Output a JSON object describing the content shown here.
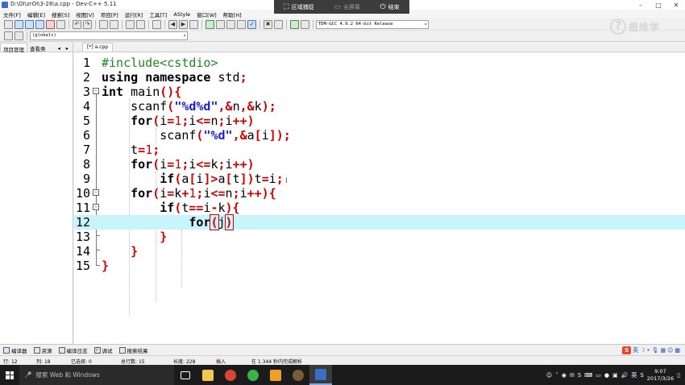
{
  "window": {
    "title": "D:\\OI\\zrOI\\3-26\\a.cpp - Dev-C++ 5.11"
  },
  "capture_bar": {
    "region": "区域捕捉",
    "fullscreen": "全屏幕",
    "end": "结束"
  },
  "menu": [
    "文件[F]",
    "编辑[E]",
    "搜索[S]",
    "视图[V]",
    "项目[P]",
    "运行[R]",
    "工具[T]",
    "AStyle",
    "窗口[W]",
    "帮助[H]"
  ],
  "toolbar": {
    "compiler_select": "TDM-GCC 4.9.2 64-bit Release",
    "scope_select": "(globals)"
  },
  "watermark": {
    "text": "根维学"
  },
  "left_panel": {
    "tabs": [
      "项目管理",
      "查看类"
    ]
  },
  "editor": {
    "file_tab": "[*] a.cpp",
    "line_numbers": [
      "1",
      "2",
      "3",
      "4",
      "5",
      "6",
      "7",
      "8",
      "9",
      "10",
      "11",
      "12",
      "13",
      "14",
      "15"
    ]
  },
  "bottom_tabs": [
    "编译器",
    "资源",
    "编译日志",
    "调试",
    "搜索结果"
  ],
  "ime": {
    "label": "英"
  },
  "status": {
    "row_label": "行:",
    "row": "12",
    "col_label": "列:",
    "col": "18",
    "selected_label": "已选择:",
    "selected": "0",
    "total_label": "总行数:",
    "total": "15",
    "length_label": "长度:",
    "length": "228",
    "mode": "插入",
    "parse_msg": "在 1.344 秒内完成解析"
  },
  "taskbar": {
    "search_placeholder": "搜索 Web 和 Windows",
    "tray_lang": "英",
    "time": "9:07",
    "date": "2017/3/26"
  },
  "colors": {
    "keyword": "#000000",
    "symbol": "#d40000",
    "string": "#1a1ad6",
    "preprocessor": "#1e8a1e",
    "current_line": "#c8f4fb"
  }
}
